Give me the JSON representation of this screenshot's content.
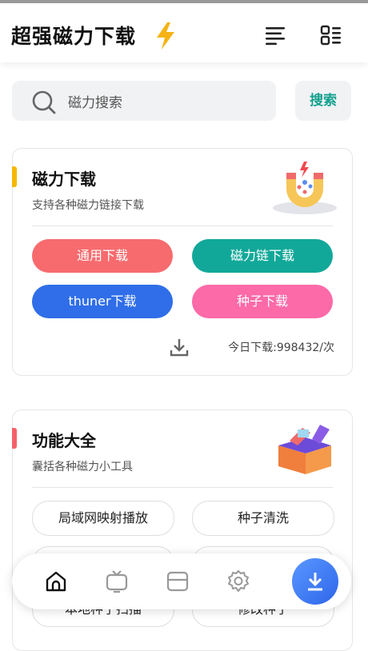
{
  "app": {
    "title": "超强磁力下载"
  },
  "search": {
    "placeholder": "磁力搜索",
    "button": "搜索"
  },
  "magnet_card": {
    "title": "磁力下载",
    "subtitle": "支持各种磁力链接下载",
    "buttons": [
      "通用下载",
      "磁力链下载",
      "thuner下载",
      "种子下载"
    ],
    "stats": "今日下载:998432/次"
  },
  "tools_card": {
    "title": "功能大全",
    "subtitle": "囊括各种磁力小工具",
    "items": [
      "局域网映射播放",
      "种子清洗",
      "",
      "",
      "本地种子扫描",
      "修改种子"
    ]
  },
  "nav": {
    "items": [
      "home-icon",
      "tv-icon",
      "layout-icon",
      "settings-icon"
    ],
    "active": "home-icon",
    "fab": "download-icon"
  },
  "colors": {
    "accent_teal": "#13a08e",
    "red": "#f76b6e",
    "teal": "#11a899",
    "blue": "#2f6ee8",
    "pink": "#fc6aa8",
    "yellow_accent": "#f5b800",
    "red_accent": "#f6606a"
  }
}
